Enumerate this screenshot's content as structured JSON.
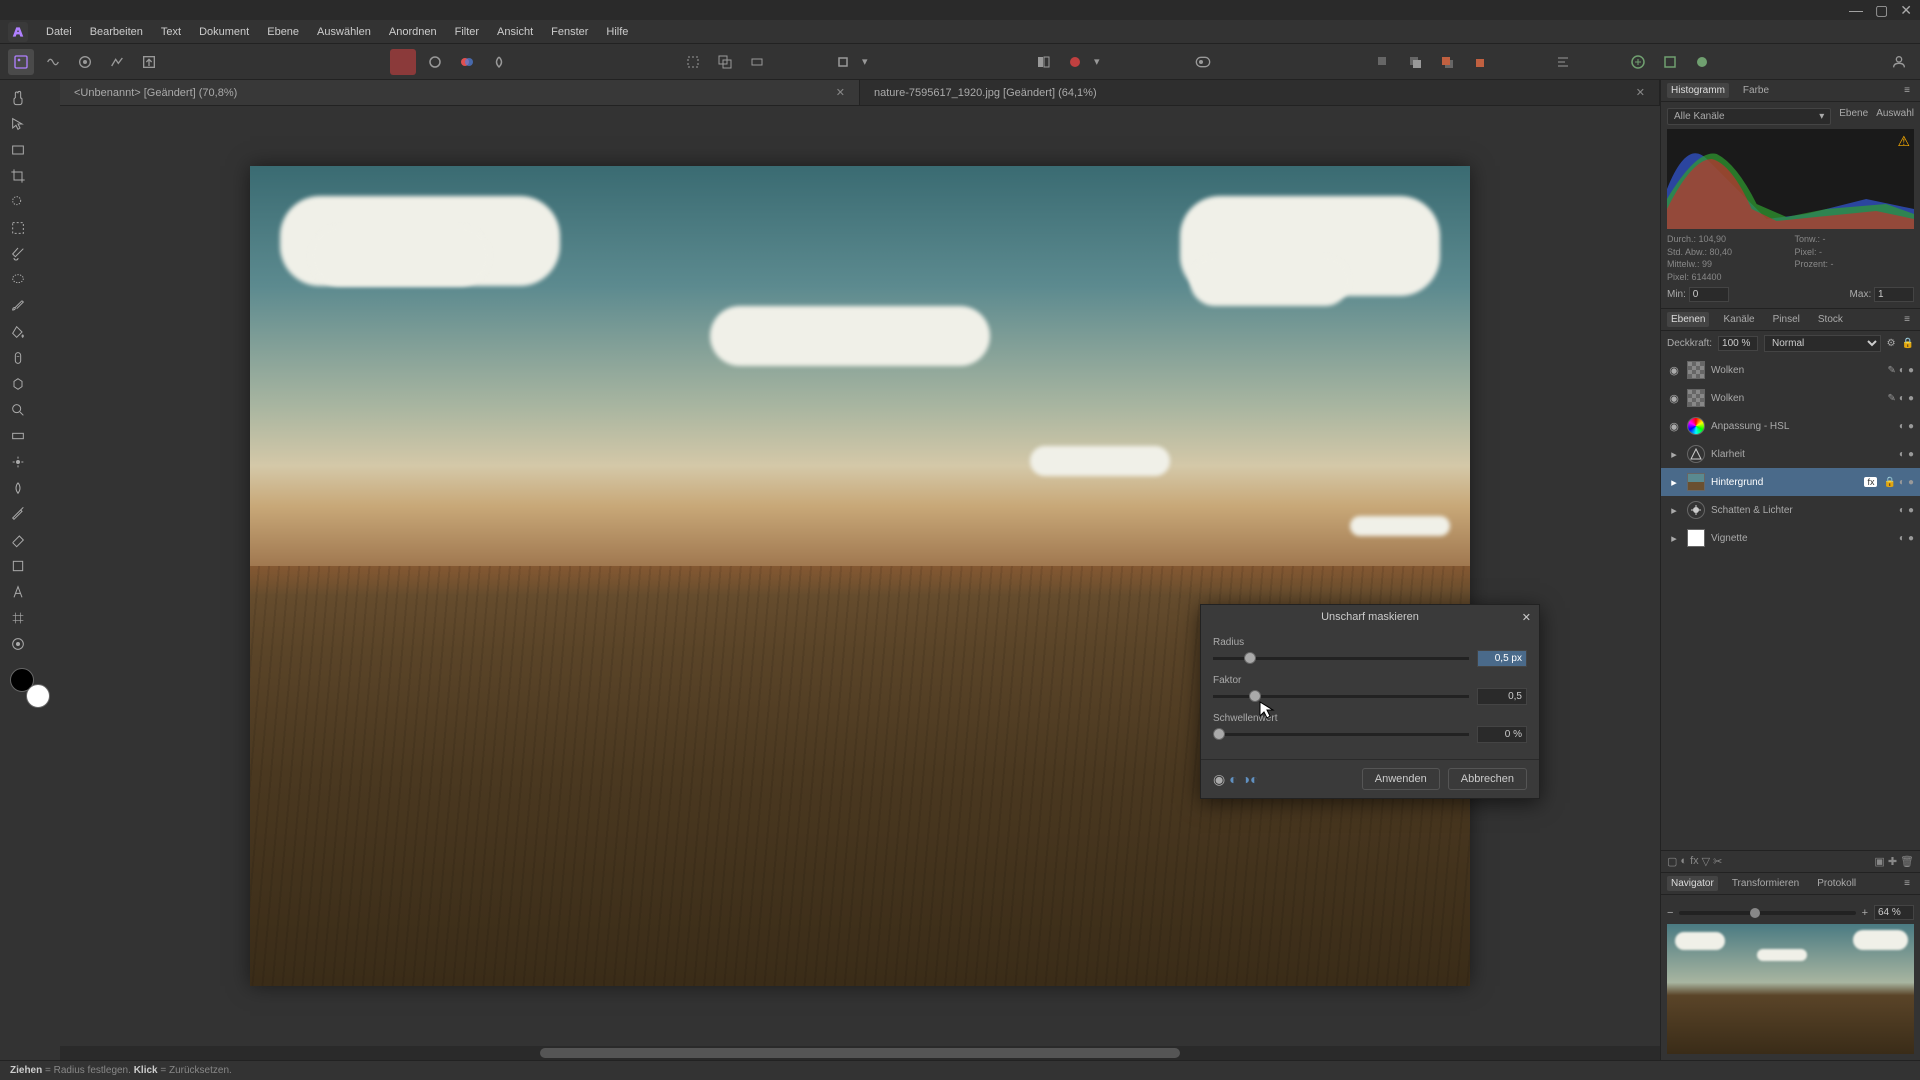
{
  "menu": {
    "items": [
      "Datei",
      "Bearbeiten",
      "Text",
      "Dokument",
      "Ebene",
      "Auswählen",
      "Anordnen",
      "Filter",
      "Ansicht",
      "Fenster",
      "Hilfe"
    ]
  },
  "tabs": [
    {
      "label": "<Unbenannt> [Geändert] (70,8%)",
      "active": true
    },
    {
      "label": "nature-7595617_1920.jpg [Geändert] (64,1%)",
      "active": false
    }
  ],
  "histogram_panel": {
    "tabs": [
      "Histogramm",
      "Farbe"
    ],
    "channel": "Alle Kanäle",
    "right_labels": [
      "Ebene",
      "Auswahl"
    ],
    "stats": {
      "durch": "Durch.: 104,90",
      "stdabw": "Std. Abw.: 80,40",
      "mittelw": "Mittelw.: 99",
      "pixel": "Pixel: 614400",
      "tonw": "Tonw.: -",
      "pixelr": "Pixel: -",
      "prozent": "Prozent: -"
    },
    "min_label": "Min:",
    "min_val": "0",
    "max_label": "Max:",
    "max_val": "1"
  },
  "layers_panel": {
    "tabs": [
      "Ebenen",
      "Kanäle",
      "Pinsel",
      "Stock"
    ],
    "opacity_label": "Deckkraft:",
    "opacity_val": "100 %",
    "blend": "Normal",
    "layers": [
      {
        "name": "Wolken",
        "type": "checker",
        "vis": true
      },
      {
        "name": "Wolken",
        "type": "checker",
        "vis": true
      },
      {
        "name": "Anpassung - HSL",
        "type": "adj",
        "vis": true
      },
      {
        "name": "Klarheit",
        "type": "adj-tri",
        "vis": false
      },
      {
        "name": "Hintergrund",
        "type": "image",
        "vis": false,
        "selected": true,
        "fx": true,
        "lock": true
      },
      {
        "name": "Schatten & Lichter",
        "type": "adj-sun",
        "vis": false
      },
      {
        "name": "Vignette",
        "type": "square",
        "vis": false
      }
    ]
  },
  "nav_panel": {
    "tabs": [
      "Navigator",
      "Transformieren",
      "Protokoll"
    ],
    "zoom": "64 %"
  },
  "dialog": {
    "title": "Unscharf maskieren",
    "radius_label": "Radius",
    "radius_val": "0,5 px",
    "faktor_label": "Faktor",
    "faktor_val": "0,5",
    "schwelle_label": "Schwellenwert",
    "schwelle_val": "0 %",
    "apply": "Anwenden",
    "cancel": "Abbrechen"
  },
  "status": {
    "drag": "Ziehen",
    "drag_text": " = Radius festlegen. ",
    "click": "Klick",
    "click_text": " = Zurücksetzen."
  }
}
